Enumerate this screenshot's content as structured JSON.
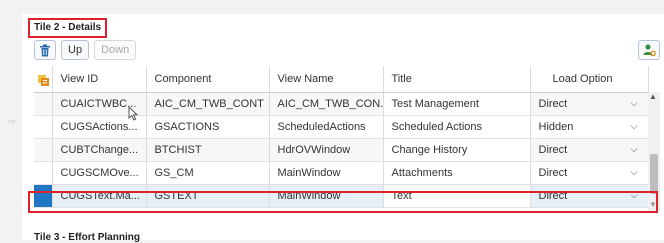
{
  "tile": {
    "title": "Tile 2 - Details"
  },
  "toolbar": {
    "delete_icon": "trash-icon",
    "up_label": "Up",
    "down_label": "Down",
    "personalize_icon": "person-settings-icon"
  },
  "table": {
    "columns": [
      "View ID",
      "Component",
      "View Name",
      "Title",
      "Load Option"
    ],
    "rows": [
      {
        "view_id": "CUAICTWBC...",
        "component": "AIC_CM_TWB_CONT",
        "view_name": "AIC_CM_TWB_CON...",
        "title": "Test Management",
        "load_option": "Direct"
      },
      {
        "view_id": "CUGSActions...",
        "component": "GSACTIONS",
        "view_name": "ScheduledActions",
        "title": "Scheduled Actions",
        "load_option": "Hidden"
      },
      {
        "view_id": "CUBTChange...",
        "component": "BTCHIST",
        "view_name": "HdrOVWindow",
        "title": "Change History",
        "load_option": "Direct"
      },
      {
        "view_id": "CUGSCMOve...",
        "component": "GS_CM",
        "view_name": "MainWindow",
        "title": "Attachments",
        "load_option": "Direct"
      },
      {
        "view_id": "CUGSText.Ma...",
        "component": "GSTEXT",
        "view_name": "MainWindow",
        "title": "Text",
        "load_option": "Direct"
      }
    ]
  },
  "next_tile": {
    "title": "Tile 3 - Effort Planning"
  },
  "colors": {
    "highlight": "#e0202a",
    "selected": "#1f77c4"
  }
}
